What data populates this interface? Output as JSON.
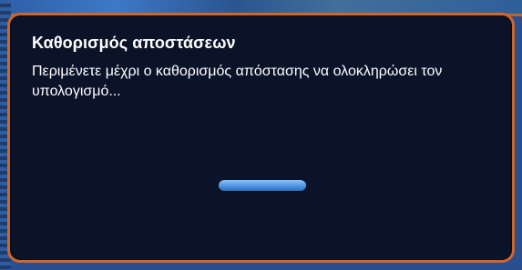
{
  "dialog": {
    "title": "Καθορισμός αποστάσεων",
    "message": "Περιμένετε μέχρι ο καθορισμός απόστασης να ολοκληρώσει τον υπολογισμό...",
    "progress": {
      "state": "indeterminate"
    }
  },
  "colors": {
    "dialog_background": "#0b1329",
    "dialog_border": "#d0662a",
    "text": "#ffffff",
    "progress": "#4f95df",
    "background": "#2a4f8f"
  }
}
